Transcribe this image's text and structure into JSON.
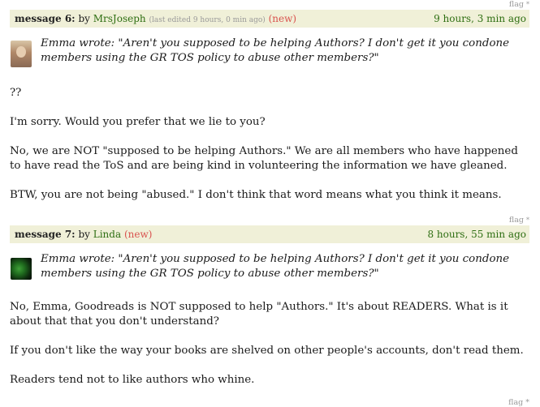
{
  "messages": [
    {
      "flag": "flag",
      "label": "message 6:",
      "by": "by",
      "user": "MrsJoseph",
      "edited": "(last edited 9 hours, 0 min ago)",
      "new_badge": "(new)",
      "time": "9 hours, 3 min ago",
      "quote": "Emma wrote: \"Aren't you supposed to be helping Authors? I don't get it you condone members using the GR TOS policy to abuse other members?\"",
      "paragraphs": [
        "??",
        "I'm sorry. Would you prefer that we lie to you?",
        "No, we are NOT \"supposed to be helping Authors.\" We are all members who have happened to have read the ToS and are being kind in volunteering the information we have gleaned.",
        "BTW, you are not being \"abused.\" I don't think that word means what you think it means."
      ]
    },
    {
      "flag": "flag",
      "label": "message 7:",
      "by": "by",
      "user": "Linda",
      "new_badge": "(new)",
      "time": "8 hours, 55 min ago",
      "quote": "Emma wrote: \"Aren't you supposed to be helping Authors? I don't get it you condone members using the GR TOS policy to abuse other members?\"",
      "paragraphs": [
        "No, Emma, Goodreads is NOT supposed to help \"Authors.\" It's about READERS. What is it about that that you don't understand?",
        "If you don't like the way your books are shelved on other people's accounts, don't read them.",
        "Readers tend not to like authors who whine."
      ]
    }
  ],
  "footer_flag": "flag"
}
